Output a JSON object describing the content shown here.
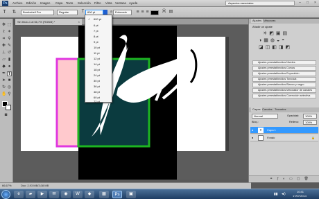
{
  "menubar": {
    "logo": "Ps",
    "items": [
      "Archivo",
      "Edición",
      "Imagen",
      "Capa",
      "Texto",
      "Selección",
      "Filtro",
      "Vista",
      "Ventana",
      "Ayuda"
    ],
    "workspace": "Aspectos esenciales"
  },
  "options": {
    "font_family": "Bombshell Pro",
    "font_style": "Regular",
    "font_size": "600 pt",
    "antialias": "Enfocado"
  },
  "document": {
    "tab_title": "Sin título-1 al 66,7% (RGB/8) *",
    "zoom": "66,67%",
    "doc_size": "Doc: 2,93 MB/3,08 MB"
  },
  "size_dropdown": {
    "items": [
      "6 pt",
      "7 pt",
      "8 pt",
      "9 pt",
      "10 pt",
      "11 pt",
      "12 pt",
      "14 pt",
      "18 pt",
      "24 pt",
      "30 pt",
      "36 pt",
      "48 pt",
      "60 pt",
      "72 pt"
    ],
    "selected": "600 pt"
  },
  "right_panel": {
    "tabs": [
      "Ajustes",
      "Máscaras"
    ],
    "subtitle": "Añadir un ajuste",
    "presets": [
      "Ajustes preestablecidos Niveles",
      "Ajustes preestablecidos Curvas",
      "Ajustes preestablecidos Exposición",
      "Ajustes preestablecidos Tono/sat.",
      "Ajustes preestablecidos Blanco y negro",
      "Ajustes preestablecidos Mezclador de canales",
      "Ajustes preestablecidos Corrección selectiva"
    ],
    "layers_tabs": [
      "Capas",
      "Canales",
      "Trazados"
    ],
    "blend_mode": "Normal",
    "opacity_label": "Opacidad:",
    "opacity": "100%",
    "fill_label": "Relleno:",
    "fill": "100%",
    "lock_label": "Bloq.:",
    "layers": [
      {
        "name": "Capa 1",
        "selected": true
      },
      {
        "name": "Fondo",
        "selected": false
      }
    ]
  },
  "taskbar": {
    "time": "10:41",
    "date": "17/07/2014"
  },
  "colors": {
    "selection_blue": "#3399ff",
    "magenta_rect": "#e037e0",
    "green_rect": "#1db521",
    "pink_fill": "#ffc9cd",
    "teal_fill": "#0b3b3f"
  }
}
